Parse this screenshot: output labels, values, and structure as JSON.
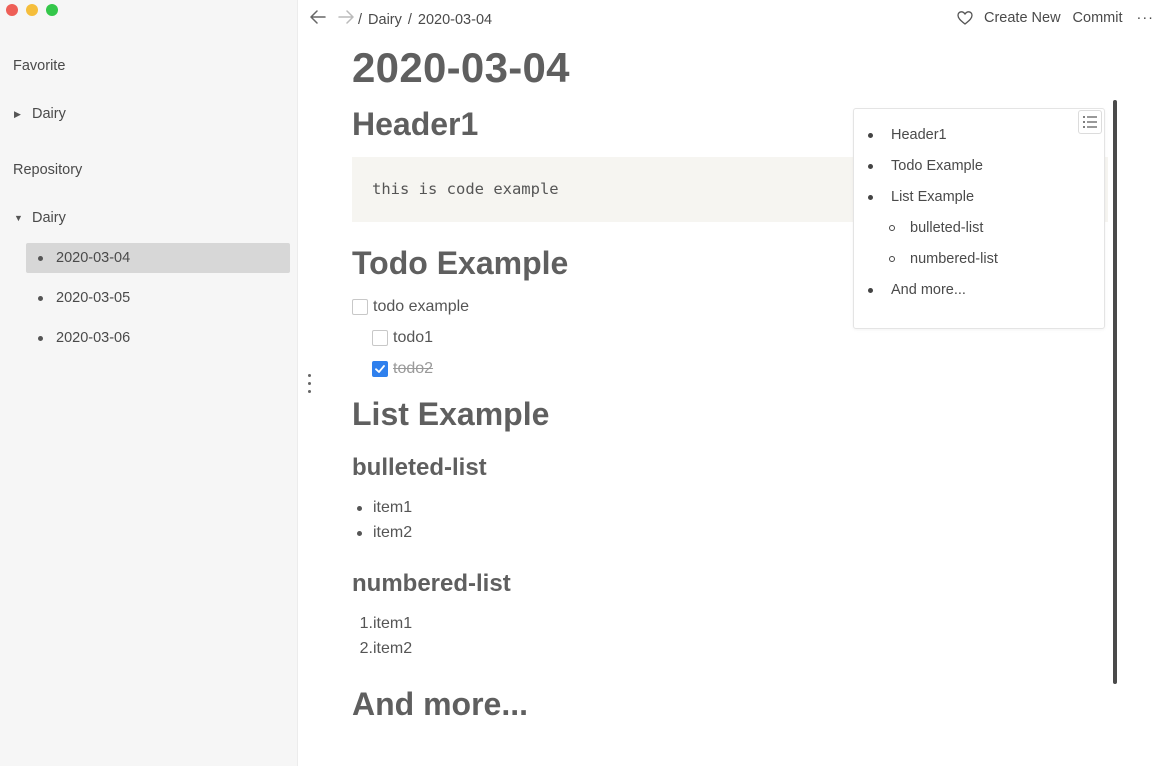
{
  "sidebar": {
    "favorite_title": "Favorite",
    "favorite_items": [
      {
        "label": "Dairy",
        "expanded": false
      }
    ],
    "repository_title": "Repository",
    "repository_items": [
      {
        "label": "Dairy",
        "expanded": true
      }
    ],
    "files": [
      {
        "label": "2020-03-04",
        "active": true
      },
      {
        "label": "2020-03-05",
        "active": false
      },
      {
        "label": "2020-03-06",
        "active": false
      }
    ]
  },
  "topbar": {
    "breadcrumb": [
      "/",
      "Dairy",
      "/",
      "2020-03-04"
    ],
    "create_new_label": "Create New",
    "commit_label": "Commit",
    "more_label": "···"
  },
  "doc": {
    "title": "2020-03-04",
    "header1": "Header1",
    "code": "this is code example",
    "todo_heading": "Todo Example",
    "todos": [
      {
        "label": "todo example",
        "checked": false
      },
      {
        "label": "todo1",
        "checked": false
      },
      {
        "label": "todo2",
        "checked": true
      }
    ],
    "list_heading": "List Example",
    "bulleted_heading": "bulleted-list",
    "bulleted_items": [
      "item1",
      "item2"
    ],
    "numbered_heading": "numbered-list",
    "numbered_items": [
      "item1",
      "item2"
    ],
    "more_heading": "And more..."
  },
  "toc": {
    "items": [
      {
        "label": "Header1",
        "level": 1
      },
      {
        "label": "Todo Example",
        "level": 1
      },
      {
        "label": "List Example",
        "level": 1
      },
      {
        "label": "bulleted-list",
        "level": 2
      },
      {
        "label": "numbered-list",
        "level": 2
      },
      {
        "label": "And more...",
        "level": 1
      }
    ]
  },
  "colors": {
    "sidebar_bg": "#f6f6f6",
    "active_row": "#d7d7d7",
    "checkbox_checked": "#2f80ed",
    "code_bg": "#f6f5f1"
  },
  "icons": [
    "back-arrow-icon",
    "forward-arrow-icon",
    "heart-icon",
    "toc-list-icon",
    "drag-handle-icon"
  ]
}
